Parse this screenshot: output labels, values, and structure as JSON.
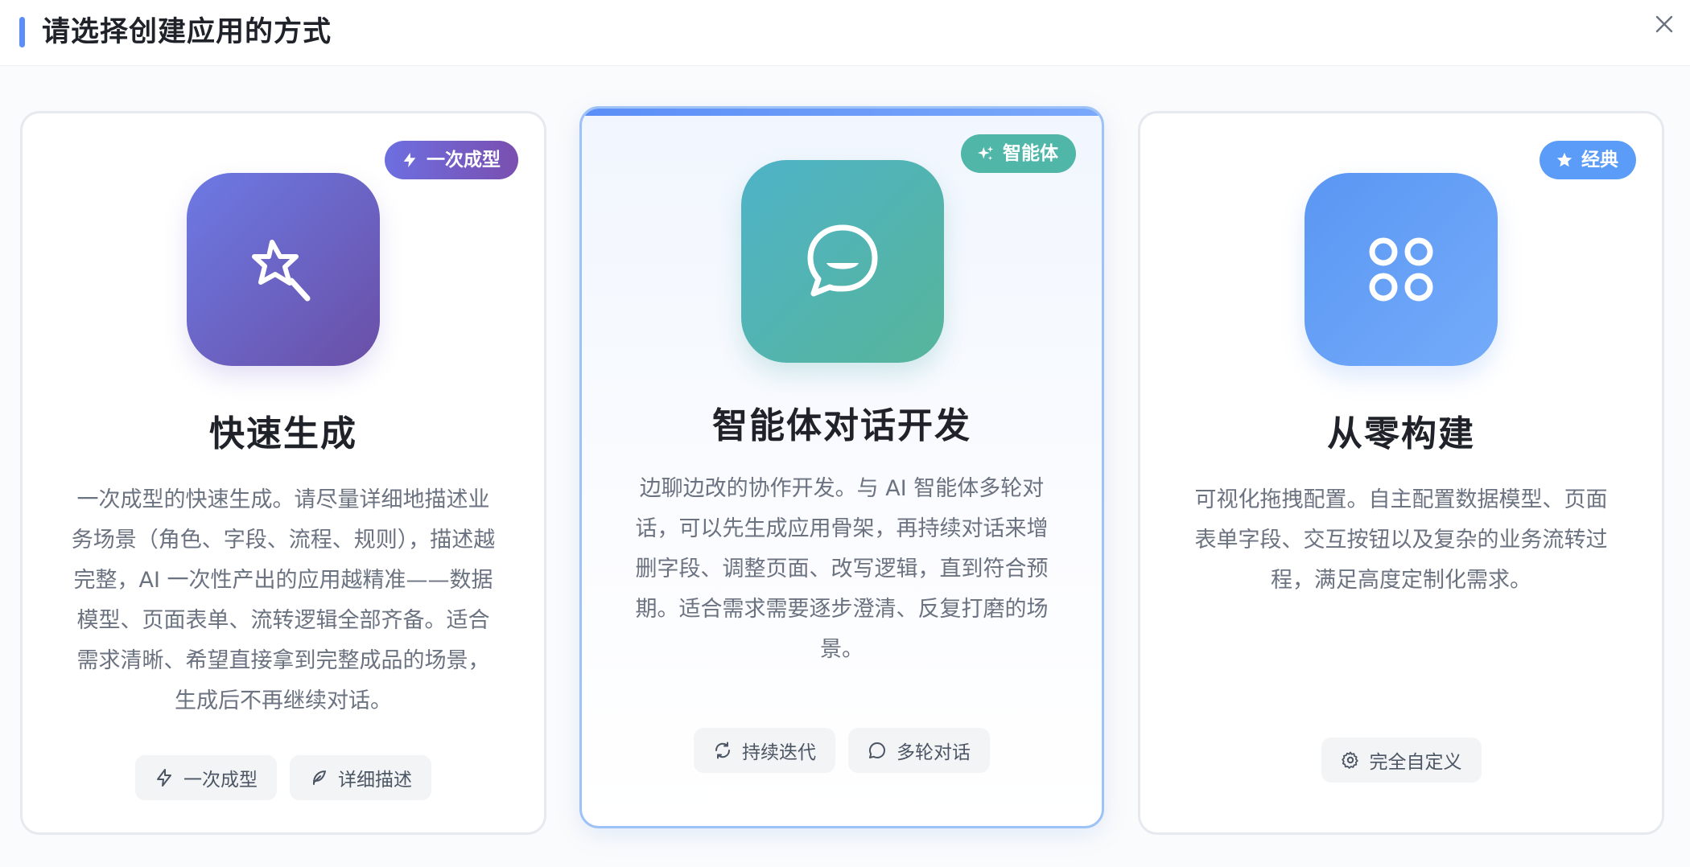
{
  "header": {
    "title": "请选择创建应用的方式",
    "accent_color": "#5b8ef7"
  },
  "close_icon": "close-icon",
  "cards": [
    {
      "badge": {
        "label": "一次成型",
        "icon": "lightning-icon"
      },
      "icon": "magic-wand-icon",
      "title": "快速生成",
      "description": "一次成型的快速生成。请尽量详细地描述业务场景（角色、字段、流程、规则），描述越完整，AI 一次性产出的应用越精准——数据模型、页面表单、流转逻辑全部齐备。适合需求清晰、希望直接拿到完整成品的场景，生成后不再继续对话。",
      "chips": [
        {
          "label": "一次成型",
          "icon": "lightning-icon"
        },
        {
          "label": "详细描述",
          "icon": "feather-icon"
        }
      ],
      "colors": {
        "gradient_start": "#6c7ae4",
        "gradient_end": "#6a4fa6"
      }
    },
    {
      "badge": {
        "label": "智能体",
        "icon": "sparkle-icon"
      },
      "icon": "chat-bubble-icon",
      "title": "智能体对话开发",
      "description": "边聊边改的协作开发。与 AI 智能体多轮对话，可以先生成应用骨架，再持续对话来增删字段、调整页面、改写逻辑，直到符合预期。适合需求需要逐步澄清、反复打磨的场景。",
      "chips": [
        {
          "label": "持续迭代",
          "icon": "refresh-icon"
        },
        {
          "label": "多轮对话",
          "icon": "message-circle-icon"
        }
      ],
      "selected": true,
      "colors": {
        "gradient_start": "#4fb3c8",
        "gradient_end": "#56b59a",
        "border": "#9cc2f7"
      }
    },
    {
      "badge": {
        "label": "经典",
        "icon": "star-icon"
      },
      "icon": "grid-circles-icon",
      "title": "从零构建",
      "description": "可视化拖拽配置。自主配置数据模型、页面表单字段、交互按钮以及复杂的业务流转过程，满足高度定制化需求。",
      "chips": [
        {
          "label": "完全自定义",
          "icon": "gear-icon"
        }
      ],
      "colors": {
        "gradient_start": "#5a97f3",
        "gradient_end": "#74abfa"
      }
    }
  ]
}
